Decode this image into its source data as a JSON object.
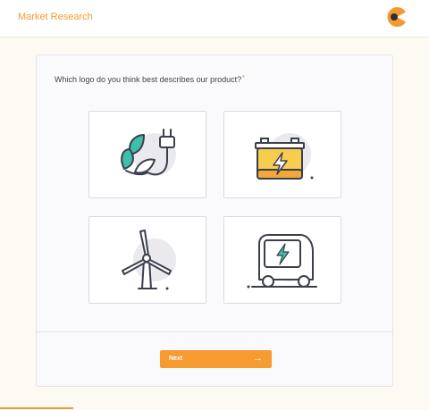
{
  "header": {
    "title": "Market Research",
    "logo_icon": "brand-logo-icon"
  },
  "question": {
    "text": "Which logo do you think best describes our product?",
    "required_mark": "*"
  },
  "options": [
    {
      "icon": "leaf-plug-icon"
    },
    {
      "icon": "battery-icon"
    },
    {
      "icon": "wind-turbine-icon"
    },
    {
      "icon": "electric-van-icon"
    }
  ],
  "next_button": {
    "label": "Next",
    "arrow": "→"
  },
  "progress": {
    "fraction": 0.17
  },
  "colors": {
    "accent": "#f59b2f",
    "teal": "#3dbfa8",
    "yellow": "#f6cd4e",
    "ink": "#3b3f4c"
  }
}
